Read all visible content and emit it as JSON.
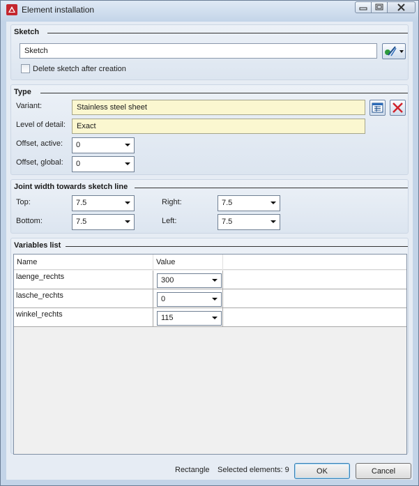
{
  "window": {
    "title": "Element installation"
  },
  "sketch": {
    "group_title": "Sketch",
    "value": "Sketch",
    "delete_label": "Delete sketch after creation"
  },
  "type": {
    "group_title": "Type",
    "variant_label": "Variant:",
    "variant_value": "Stainless steel sheet",
    "detail_label": "Level of detail:",
    "detail_value": "Exact",
    "offset_active_label": "Offset, active:",
    "offset_active_value": "0",
    "offset_global_label": "Offset, global:",
    "offset_global_value": "0"
  },
  "joint": {
    "group_title": "Joint width towards sketch line",
    "top_label": "Top:",
    "top_value": "7.5",
    "right_label": "Right:",
    "right_value": "7.5",
    "bottom_label": "Bottom:",
    "bottom_value": "7.5",
    "left_label": "Left:",
    "left_value": "7.5"
  },
  "variables": {
    "group_title": "Variables list",
    "columns": [
      "Name",
      "Value"
    ],
    "rows": [
      {
        "name": "laenge_rechts",
        "value": "300"
      },
      {
        "name": "lasche_rechts",
        "value": "0"
      },
      {
        "name": "winkel_rechts",
        "value": "115"
      }
    ]
  },
  "footer": {
    "mode": "Rectangle",
    "selected": "Selected elements: 9",
    "ok_label": "OK",
    "cancel_label": "Cancel"
  },
  "icons": {
    "app": "app-logo-icon",
    "sketch_pick": "sketch-pick-icon",
    "catalog": "catalog-icon",
    "delete": "delete-red-x-icon"
  }
}
